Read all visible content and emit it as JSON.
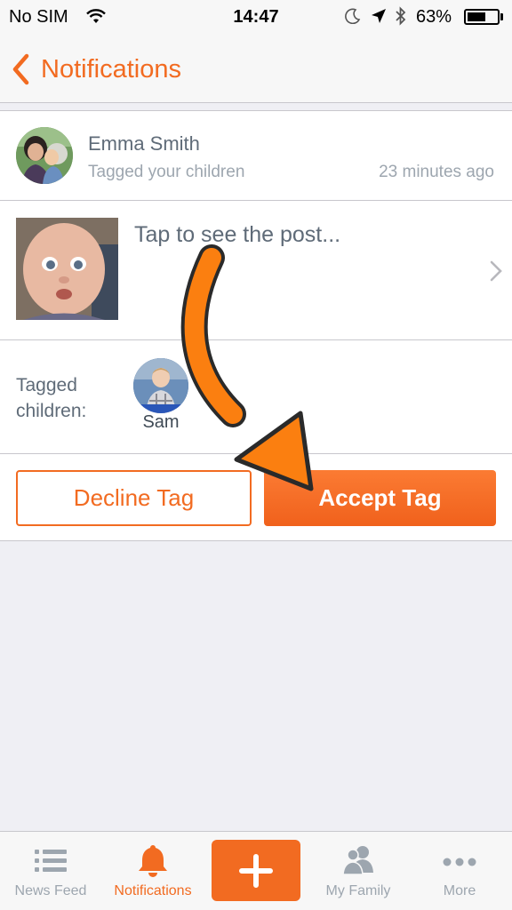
{
  "status_bar": {
    "carrier": "No SIM",
    "time": "14:47",
    "battery_percent": "63%",
    "battery_level": 0.63
  },
  "nav": {
    "back_label": "Notifications",
    "accent_color": "#f26b21"
  },
  "notification": {
    "sender_name": "Emma Smith",
    "action_text": "Tagged your children",
    "time_ago": "23 minutes ago",
    "post_prompt": "Tap to see the post...",
    "tagged_label": "Tagged children:",
    "tagged_children": [
      {
        "name": "Sam"
      }
    ],
    "decline_label": "Decline Tag",
    "accept_label": "Accept Tag"
  },
  "tab_bar": {
    "items": [
      {
        "label": "News Feed",
        "icon": "list-icon",
        "active": false
      },
      {
        "label": "Notifications",
        "icon": "bell-icon",
        "active": true
      },
      {
        "label": "",
        "icon": "plus-icon",
        "active": false
      },
      {
        "label": "My Family",
        "icon": "people-icon",
        "active": false
      },
      {
        "label": "More",
        "icon": "more-dots-icon",
        "active": false
      }
    ]
  }
}
